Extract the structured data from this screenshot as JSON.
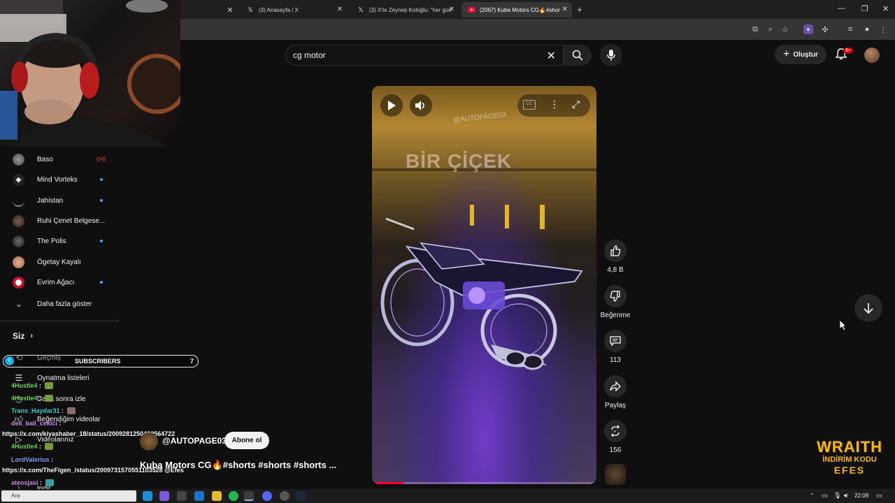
{
  "browser": {
    "tabs": [
      {
        "title": "(3) Anasayfa / X",
        "icon": "x-logo-icon"
      },
      {
        "title": "(3) X'te Zeynep Koloğlu: \"her gün",
        "icon": "x-logo-icon"
      },
      {
        "title": "(2067) Kuba Motors CG🔥#shor",
        "icon": "youtube-logo-icon",
        "active": true
      }
    ],
    "new_tab": "+"
  },
  "search": {
    "query": "cg motor"
  },
  "header": {
    "create_label": "Oluştur",
    "notif_badge": "9+"
  },
  "sidebar": {
    "subscriptions": [
      {
        "name": "Baso",
        "status": "live"
      },
      {
        "name": "Mind Vorteks",
        "status": "new"
      },
      {
        "name": "Jahistan",
        "status": "new"
      },
      {
        "name": "Ruhi Çenet Belgese...",
        "status": ""
      },
      {
        "name": "The Polis",
        "status": "new"
      },
      {
        "name": "Ögetay Kayalı",
        "status": ""
      },
      {
        "name": "Evrim Ağacı",
        "status": "new"
      }
    ],
    "show_more": "Daha fazla göster",
    "you_section": "Siz",
    "items": [
      "Geçmiş",
      "Oynatma listeleri",
      "Daha sonra izle",
      "Beğendiğim videolar",
      "Videolarınız",
      "İndir"
    ]
  },
  "stream_overlay": {
    "subscribers": {
      "current": "0",
      "label": "SUBSCRIBERS",
      "goal": "7"
    },
    "chat": [
      {
        "user": "4Hustle4",
        "message": "",
        "color": "#6cd35a"
      },
      {
        "user": "4Hustle4",
        "message": "",
        "color": "#6cd35a"
      },
      {
        "user": "Trans_Haydar31",
        "message": "",
        "color": "#3fd0d4"
      },
      {
        "user": "deli_bali_cekici",
        "message": "",
        "color": "#d58cf0"
      },
      {
        "user": "",
        "message": "https://x.com/kiyashaber_18/status/2009281250490564722",
        "color": "#ffffff"
      },
      {
        "user": "4Hustle4",
        "message": "",
        "color": "#6cd35a"
      },
      {
        "user": "LordValerius",
        "message": "",
        "color": "#8f9cf7"
      },
      {
        "user": "",
        "message": "https://x.com/TheFigen_/status/2009731570551103528 @Efes",
        "color": "#ffffff"
      },
      {
        "user": "ateosjasi",
        "message": "",
        "color": "#d58cf0"
      }
    ]
  },
  "video": {
    "overlay_text": "BİR ÇİÇEK",
    "watermark": "@AUTOPAGE03",
    "progress": 0.14
  },
  "actions": {
    "likes": "4,8 B",
    "dislike": "Beğenme",
    "comments": "113",
    "share": "Paylaş",
    "remix": "156"
  },
  "channel": {
    "name": "@AUTOPAGE03",
    "subscribe": "Abone ol"
  },
  "video_title": "Kuba Motors CG🔥#shorts #shorts #shorts ...",
  "sponsor": {
    "line1": "WRAITH",
    "line2": "İNDİRİM KODU",
    "line3": "EFES"
  },
  "taskbar": {
    "search_placeholder": "Ara",
    "time": "22:09"
  },
  "colors": {
    "accent": "#ff0033",
    "live": "#ff4e45",
    "new_dot": "#3ea6ff",
    "sponsor": "#f6b90b"
  }
}
